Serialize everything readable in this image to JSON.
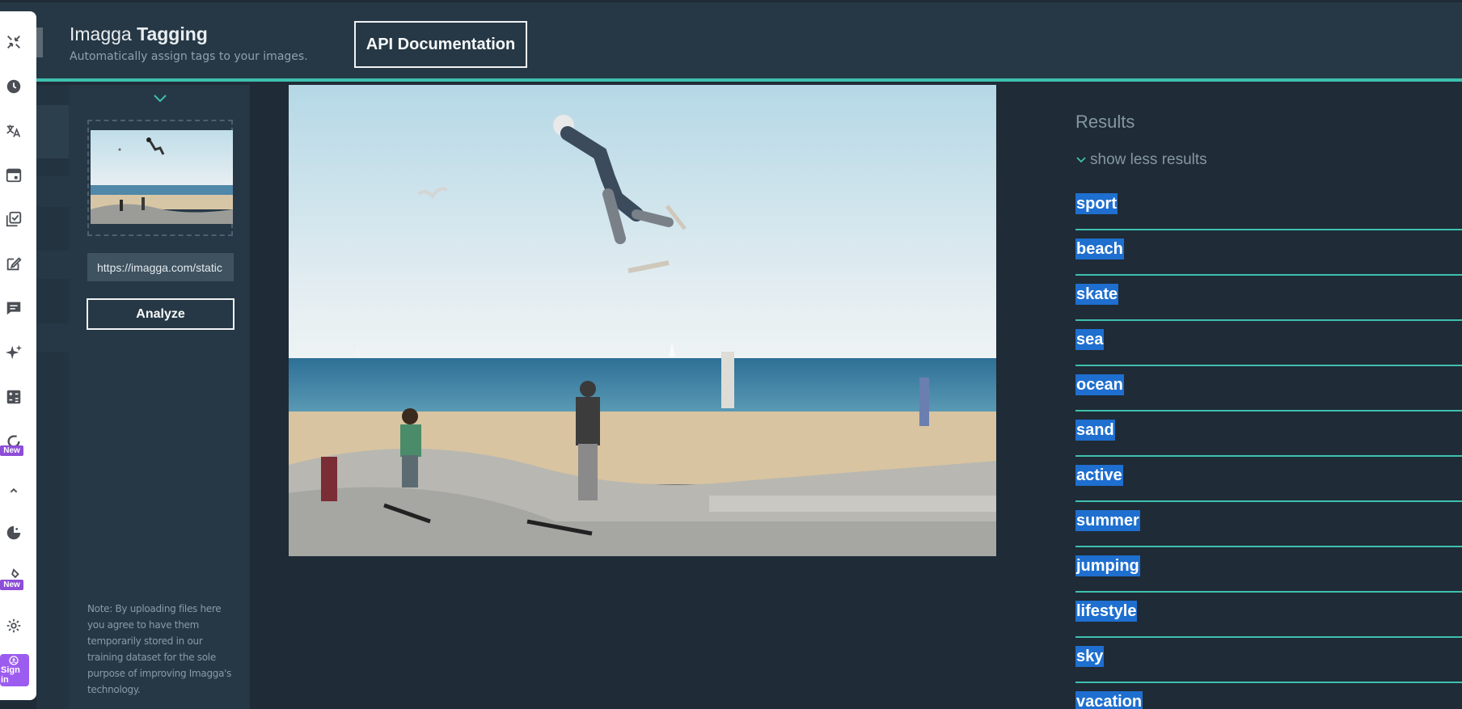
{
  "header": {
    "brand_light": "Imagga",
    "brand_bold": "Tagging",
    "subtitle": "Automatically assign tags to your images.",
    "api_button": "API Documentation"
  },
  "browser_sidebar": {
    "icons": [
      "collapse-icon",
      "history-icon",
      "translate-icon",
      "calendar-icon",
      "copy-check-icon",
      "edit-icon",
      "chat-icon",
      "sparkle-icon",
      "calculator-icon",
      "refresh-icon",
      "chevron-up-icon",
      "pacman-icon",
      "pin-icon",
      "settings-icon"
    ],
    "new_badge": "New",
    "signin_label": "Sign in"
  },
  "left_panel": {
    "url_value": "https://imagga.com/static",
    "analyze_button": "Analyze",
    "note": "Note: By uploading files here you agree to have them temporarily stored in our training dataset for the sole purpose of improving Imagga's technology."
  },
  "results": {
    "title": "Results",
    "show_less": "show less results",
    "tags": [
      "sport",
      "beach",
      "skate",
      "sea",
      "ocean",
      "sand",
      "active",
      "summer",
      "jumping",
      "lifestyle",
      "sky",
      "vacation"
    ]
  },
  "colors": {
    "accent": "#3ec0b0",
    "header_bg": "#263845",
    "page_bg": "#1f2b36",
    "selection": "#1e6fcf",
    "new_badge": "#8d4dd8"
  }
}
